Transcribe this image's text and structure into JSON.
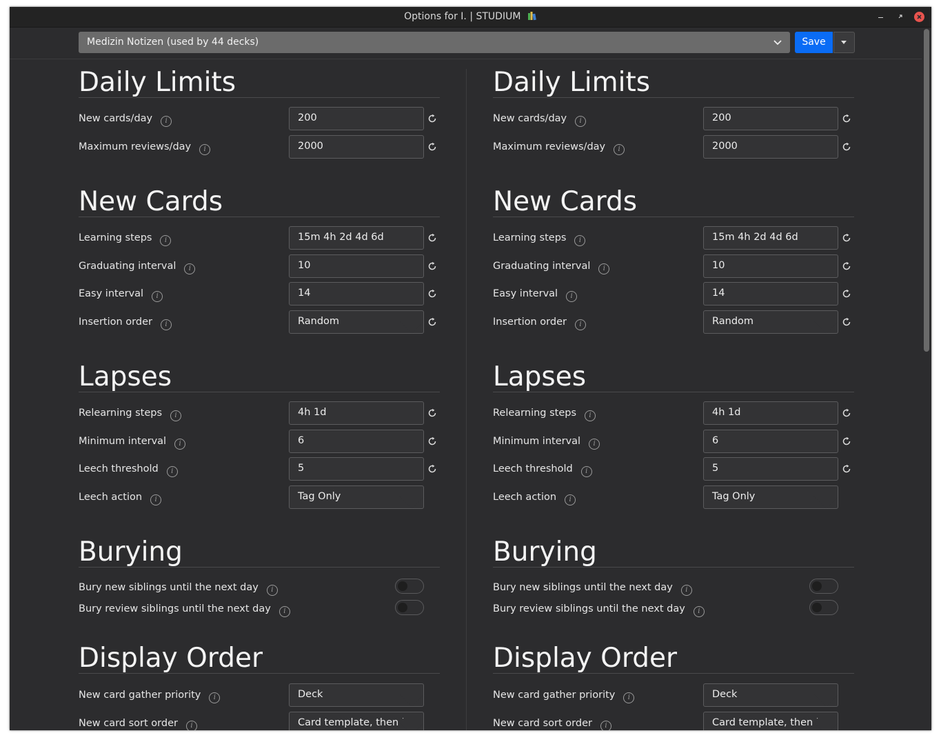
{
  "window": {
    "title": "Options for I. | STUDIUM"
  },
  "topbar": {
    "preset": "Medizin Notizen (used by 44 decks)",
    "save_label": "Save"
  },
  "columns": [
    {
      "daily_limits": {
        "title": "Daily Limits",
        "new_cards_label": "New cards/day",
        "new_cards_value": "200",
        "max_reviews_label": "Maximum reviews/day",
        "max_reviews_value": "2000"
      },
      "new_cards": {
        "title": "New Cards",
        "learning_steps_label": "Learning steps",
        "learning_steps_value": "15m 4h 2d 4d 6d",
        "graduating_label": "Graduating interval",
        "graduating_value": "10",
        "easy_label": "Easy interval",
        "easy_value": "14",
        "insertion_label": "Insertion order",
        "insertion_value": "Random"
      },
      "lapses": {
        "title": "Lapses",
        "relearning_label": "Relearning steps",
        "relearning_value": "4h 1d",
        "min_interval_label": "Minimum interval",
        "min_interval_value": "6",
        "leech_threshold_label": "Leech threshold",
        "leech_threshold_value": "5",
        "leech_action_label": "Leech action",
        "leech_action_value": "Tag Only"
      },
      "burying": {
        "title": "Burying",
        "bury_new_label": "Bury new siblings until the next day",
        "bury_new_on": false,
        "bury_review_label": "Bury review siblings until the next day",
        "bury_review_on": false
      },
      "display_order": {
        "title": "Display Order",
        "gather_label": "New card gather priority",
        "gather_value": "Deck",
        "sort_label": "New card sort order",
        "sort_value": "Card template, then l"
      }
    },
    {
      "daily_limits": {
        "title": "Daily Limits",
        "new_cards_label": "New cards/day",
        "new_cards_value": "200",
        "max_reviews_label": "Maximum reviews/day",
        "max_reviews_value": "2000"
      },
      "new_cards": {
        "title": "New Cards",
        "learning_steps_label": "Learning steps",
        "learning_steps_value": "15m 4h 2d 4d 6d",
        "graduating_label": "Graduating interval",
        "graduating_value": "10",
        "easy_label": "Easy interval",
        "easy_value": "14",
        "insertion_label": "Insertion order",
        "insertion_value": "Random"
      },
      "lapses": {
        "title": "Lapses",
        "relearning_label": "Relearning steps",
        "relearning_value": "4h 1d",
        "min_interval_label": "Minimum interval",
        "min_interval_value": "6",
        "leech_threshold_label": "Leech threshold",
        "leech_threshold_value": "5",
        "leech_action_label": "Leech action",
        "leech_action_value": "Tag Only"
      },
      "burying": {
        "title": "Burying",
        "bury_new_label": "Bury new siblings until the next day",
        "bury_new_on": false,
        "bury_review_label": "Bury review siblings until the next day",
        "bury_review_on": false
      },
      "display_order": {
        "title": "Display Order",
        "gather_label": "New card gather priority",
        "gather_value": "Deck",
        "sort_label": "New card sort order",
        "sort_value": "Card template, then l"
      }
    }
  ],
  "colors": {
    "accent": "#0a6cf5",
    "background": "#2c2c2e",
    "close_button": "#e9544e"
  }
}
